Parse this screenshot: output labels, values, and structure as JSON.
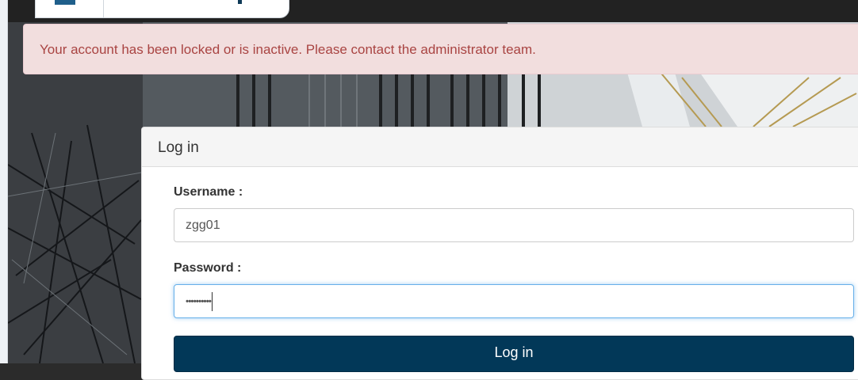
{
  "alert": {
    "message": "Your account has been locked or is inactive. Please contact the administrator team."
  },
  "login_panel": {
    "title": "Log in",
    "username_label": "Username :",
    "username_value": "zgg01",
    "password_label": "Password :",
    "password_masked": "••••••••••",
    "submit_label": "Log in"
  },
  "colors": {
    "alert_bg": "#f2dede",
    "alert_text": "#a94442",
    "button_bg": "#023858",
    "focus_border": "#66afe9"
  }
}
